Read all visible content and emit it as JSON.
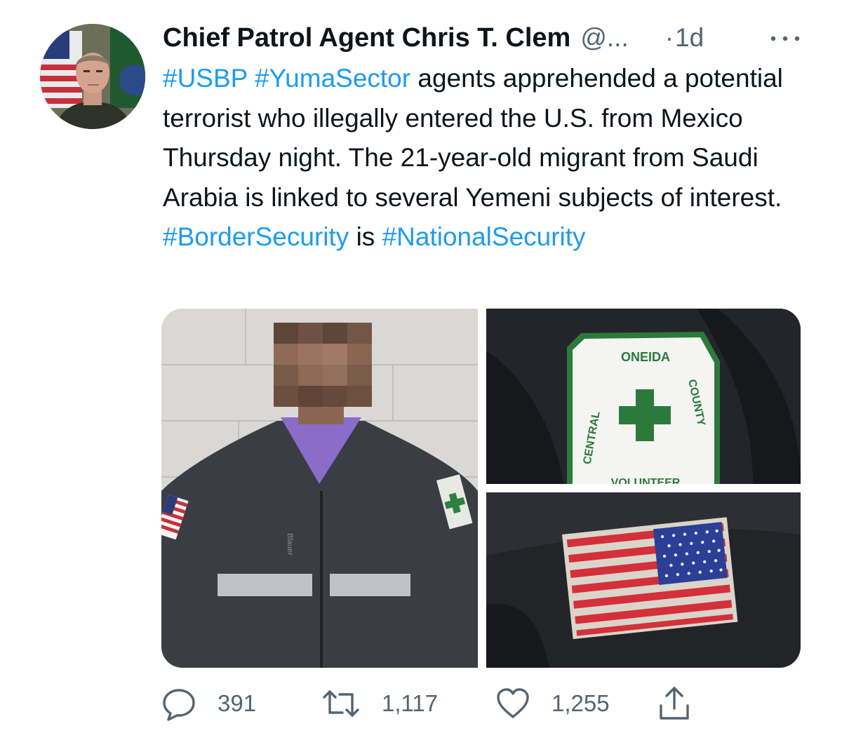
{
  "author": {
    "display_name": "Chief Patrol Agent Chris T. Clem",
    "handle": "@...",
    "separator": "·",
    "time": "1d"
  },
  "tweet": {
    "line1_tags": [
      "#USBP",
      "#YumaSector"
    ],
    "line1_rest": " agents apprehended a potential terrorist who illegally entered the U.S. from Mexico Thursday night. The 21-year-old migrant from Saudi Arabia is linked to several Yemeni subjects of interest.",
    "tag_border": "#BorderSecurity",
    "connector": " is ",
    "tag_national": "#NationalSecurity"
  },
  "media": {
    "patch_text": {
      "top": "ONEIDA",
      "left": "CENTRAL",
      "right": "COUNTY",
      "bottom": "VOLUNTEER"
    },
    "jacket_label": "Blauer"
  },
  "actions": {
    "reply_count": "391",
    "retweet_count": "1,117",
    "like_count": "1,255"
  },
  "icons": {
    "reply": "reply-icon",
    "retweet": "retweet-icon",
    "like": "heart-icon",
    "share": "share-icon",
    "more": "more-icon"
  },
  "colors": {
    "link": "#1d9bf0",
    "secondary_text": "#536471",
    "primary_text": "#0f1419"
  }
}
